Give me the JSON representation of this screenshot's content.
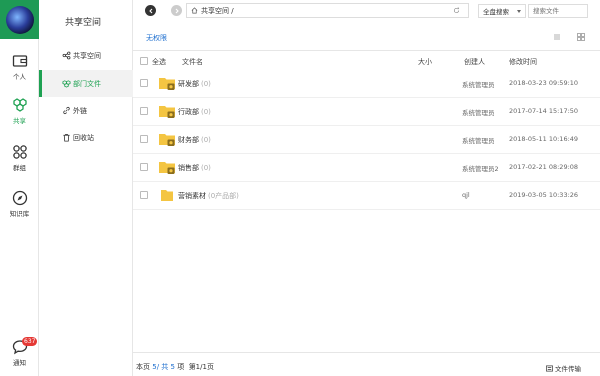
{
  "rail": {
    "items": [
      {
        "label": "个人"
      },
      {
        "label": "共享"
      },
      {
        "label": "群组"
      },
      {
        "label": "知识库"
      },
      {
        "label": "通知",
        "badge": "637"
      }
    ]
  },
  "nav2": {
    "title": "共享空间",
    "items": [
      {
        "label": "共享空间"
      },
      {
        "label": "部门文件"
      },
      {
        "label": "外链"
      },
      {
        "label": "回收站"
      }
    ]
  },
  "toolbar": {
    "path": "共享空间 /",
    "scope": "全盘搜索",
    "search_placeholder": "搜索文件"
  },
  "permission_text": "无权限",
  "table": {
    "headers": {
      "select_all": "全选",
      "name": "文件名",
      "size": "大小",
      "creator": "创建人",
      "mtime": "修改时间"
    },
    "rows": [
      {
        "name": "研发部",
        "tag": "(0)",
        "creator": "系统管理员",
        "mtime": "2018-03-23 09:59:10"
      },
      {
        "name": "行政部",
        "tag": "(0)",
        "creator": "系统管理员",
        "mtime": "2017-07-14 15:17:50"
      },
      {
        "name": "财务部",
        "tag": "(0)",
        "creator": "系统管理员",
        "mtime": "2018-05-11 10:16:49"
      },
      {
        "name": "销售部",
        "tag": "(0)",
        "creator": "系统管理员2",
        "mtime": "2017-02-21 08:29:08"
      },
      {
        "name": "营销素材",
        "tag": "(0产品部)",
        "creator": "qjl",
        "mtime": "2019-03-05 10:33:26"
      }
    ]
  },
  "footer": {
    "prefix": "本页",
    "page_count": "5",
    "mid": "/ 共",
    "total": "5",
    "suffix": "项",
    "pages": "第1/1页",
    "transfer": "文件传输"
  },
  "colors": {
    "accent": "#1ea152",
    "link": "#1e6fcf",
    "folder": "#f4c542"
  }
}
